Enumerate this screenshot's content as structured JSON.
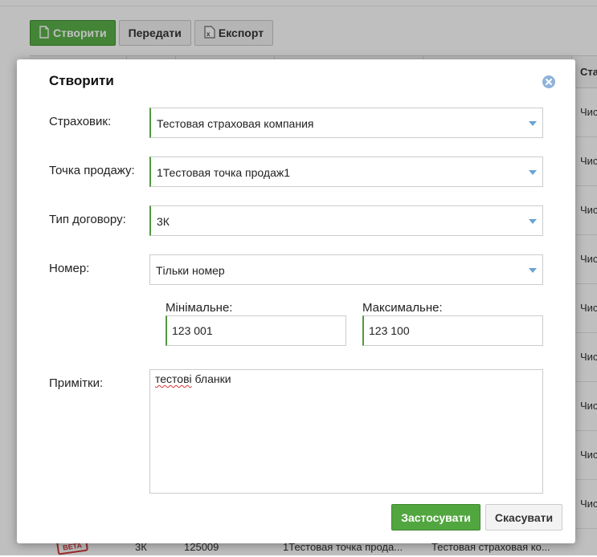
{
  "toolbar": {
    "create_label": "Створити",
    "transfer_label": "Передати",
    "export_label": "Експорт"
  },
  "grid": {
    "last_column_header": "Ста",
    "last_column_cell": "Чис",
    "last_row": {
      "badge": "BETA",
      "type": "3К",
      "number": "125009",
      "point": "1Тестовая точка прода...",
      "insurer": "Тестовая страховая ко..."
    }
  },
  "modal": {
    "title": "Створити",
    "insurer": {
      "label": "Страховик:",
      "value": "Тестовая страховая компания"
    },
    "sale_point": {
      "label": "Точка продажу:",
      "value": "1Тестовая точка продаж1"
    },
    "contract_type": {
      "label": "Тип договору:",
      "value": "3К"
    },
    "number": {
      "label": "Номер:",
      "value": "Тільки номер"
    },
    "min": {
      "label": "Мінімальне:",
      "value": "123 001"
    },
    "max": {
      "label": "Максимальне:",
      "value": "123 100"
    },
    "notes": {
      "label": "Примітки:",
      "word1": "тестові",
      "word2": "бланки"
    },
    "apply_label": "Застосувати",
    "cancel_label": "Скасувати"
  },
  "colors": {
    "primary_green": "#52a640",
    "accent_border": "#4f9a3e",
    "dropdown_arrow": "#6aa3d5",
    "close_icon": "#8fb3d9"
  }
}
